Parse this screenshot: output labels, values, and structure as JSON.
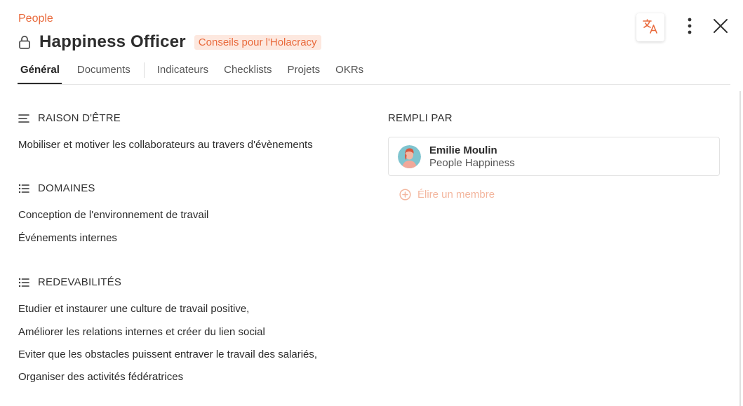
{
  "header": {
    "breadcrumb": "People",
    "title": "Happiness Officer",
    "circle_badge": "Conseils pour l'Holacracy"
  },
  "tabs": [
    {
      "label": "Général",
      "active": true
    },
    {
      "label": "Documents",
      "active": false
    },
    {
      "label": "Indicateurs",
      "active": false
    },
    {
      "label": "Checklists",
      "active": false
    },
    {
      "label": "Projets",
      "active": false
    },
    {
      "label": "OKRs",
      "active": false
    }
  ],
  "purpose": {
    "heading": "RAISON D'ÊTRE",
    "text": "Mobiliser et motiver les collaborateurs au travers d'évènements"
  },
  "domains": {
    "heading": "DOMAINES",
    "items": [
      "Conception de l'environnement de travail",
      "Événements internes"
    ]
  },
  "accountabilities": {
    "heading": "REDEVABILITÉS",
    "items": [
      "Etudier et instaurer une culture de travail positive,",
      "Améliorer les relations internes et créer du lien social",
      "Eviter que les obstacles puissent entraver le travail des salariés,",
      "Organiser des activités fédératrices"
    ]
  },
  "filled_by": {
    "heading": "REMPLI PAR",
    "member": {
      "name": "Emilie Moulin",
      "role": "People Happiness"
    },
    "elect_label": "Élire un membre"
  },
  "icons": {
    "lock": "lock-icon",
    "translate": "translate-icon",
    "more": "more-vertical-icon",
    "close": "close-icon",
    "purpose": "text-align-left-icon",
    "list": "list-icon",
    "plus": "plus-circle-icon"
  },
  "colors": {
    "accent": "#e96a3c",
    "badge_bg": "#fde8df",
    "elect_text": "#f3b69e"
  }
}
